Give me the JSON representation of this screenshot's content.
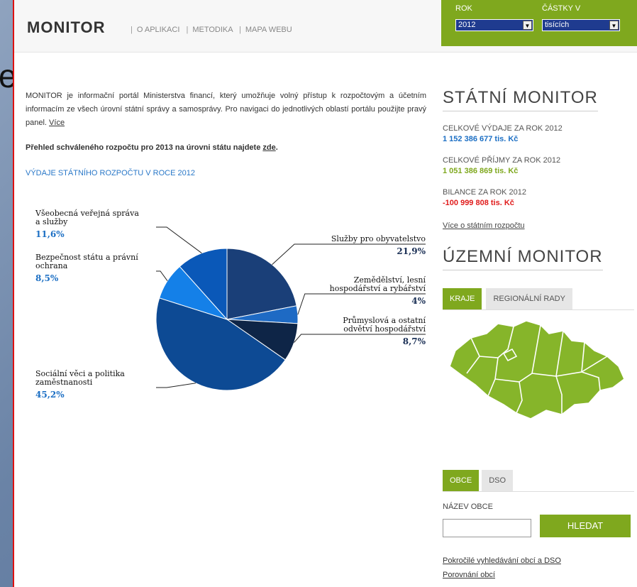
{
  "header": {
    "logo": "MONITOR",
    "nav": [
      "O APLIKACI",
      "METODIKA",
      "MAPA WEBU"
    ],
    "year_label": "ROK",
    "year_value": "2012",
    "amount_label": "ČÁSTKY V",
    "amount_value": "tisících"
  },
  "main": {
    "intro": "MONITOR je informační portál Ministerstva financí, který umožňuje volný přístup k rozpočtovým a účetním informacím ze všech úrovní státní správy a samosprávy. Pro navigaci do jednotlivých oblastí portálu použijte pravý panel.",
    "intro_link": "Více",
    "budget_note": "Přehled schváleného rozpočtu pro 2013 na úrovni státu najdete",
    "budget_link": "zde",
    "chart_heading": "VÝDAJE STÁTNÍHO ROZPOČTU V ROCE 2012"
  },
  "chart_data": {
    "type": "pie",
    "title": "VÝDAJE STÁTNÍHO ROZPOČTU V ROCE 2012",
    "slices": [
      {
        "label": "Služby pro obyvatelstvo",
        "value": 21.9,
        "display": "21,9%",
        "color": "#1a3f78"
      },
      {
        "label": "Zemědělství, lesní hospodářství a rybářství",
        "value": 4,
        "display": "4%",
        "color": "#1e6ac4"
      },
      {
        "label": "Průmyslová a ostatní odvětví hospodářství",
        "value": 8.7,
        "display": "8,7%",
        "color": "#0e2547"
      },
      {
        "label": "Sociální věci a politika zaměstnanosti",
        "value": 45.2,
        "display": "45,2%",
        "color": "#0d4a94"
      },
      {
        "label": "Bezpečnost státu a právní ochrana",
        "value": 8.5,
        "display": "8,5%",
        "color": "#1480e8"
      },
      {
        "label": "Všeobecná veřejná správa a služby",
        "value": 11.6,
        "display": "11,6%",
        "color": "#0a58b8"
      }
    ],
    "labels_lines": {
      "s0": [
        "Služby pro obyvatelstvo"
      ],
      "s1": [
        "Zemědělství, lesní",
        "hospodářství a rybářství"
      ],
      "s2": [
        "Průmyslová a ostatní",
        "odvětví hospodářství"
      ],
      "s3": [
        "Sociální věci a politika",
        "zaměstnanosti"
      ],
      "s4": [
        "Bezpečnost státu a právní",
        "ochrana"
      ],
      "s5": [
        "Všeobecná veřejná správa",
        "a služby"
      ]
    }
  },
  "state": {
    "heading": "STÁTNÍ MONITOR",
    "exp_label": "CELKOVÉ VÝDAJE ZA ROK 2012",
    "exp_value": "1 152 386 677 tis. Kč",
    "inc_label": "CELKOVÉ PŘÍJMY ZA ROK 2012",
    "inc_value": "1 051 386 869 tis. Kč",
    "bal_label": "BILANCE ZA ROK 2012",
    "bal_value": "-100 999 808 tis. Kč",
    "more_link": "Více o státním rozpočtu"
  },
  "territorial": {
    "heading": "ÚZEMNÍ MONITOR",
    "tabs": [
      "KRAJE",
      "REGIONÁLNÍ RADY"
    ],
    "tabs2": [
      "OBCE",
      "DSO"
    ],
    "search_label": "NÁZEV OBCE",
    "search_button": "HLEDAT",
    "link_advanced": "Pokročilé vyhledávání obcí a DSO",
    "link_compare": "Porovnání obcí"
  },
  "colors": {
    "accent": "#7fa81e",
    "link_blue": "#2a78c8",
    "negative": "#e01b1b"
  }
}
